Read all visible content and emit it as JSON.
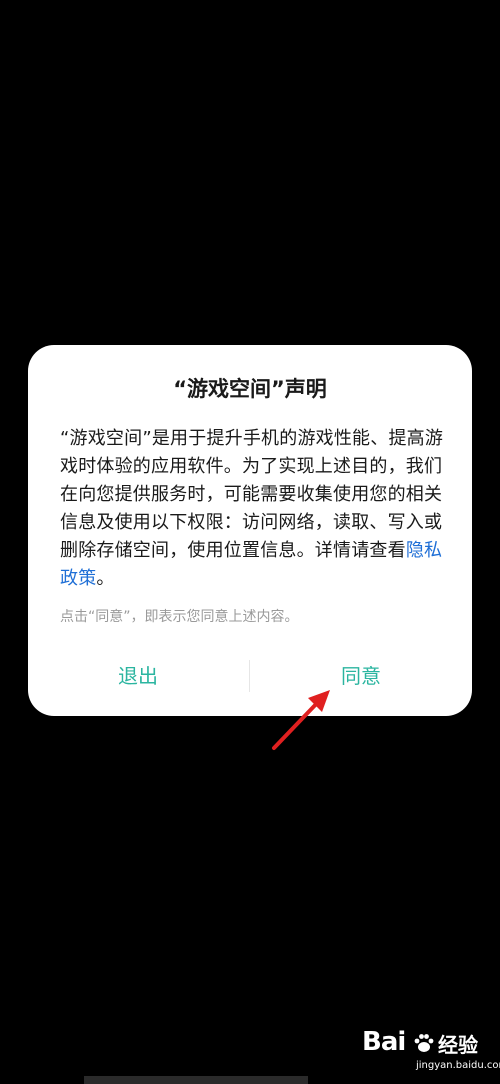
{
  "dialog": {
    "title": "“游戏空间”声明",
    "body_text": "“游戏空间”是用于提升手机的游戏性能、提高游戏时体验的应用软件。为了实现上述目的，我们在向您提供服务时，可能需要收集使用您的相关信息及使用以下权限：访问网络，读取、写入或删除存储空间，使用位置信息。详情请查看",
    "policy_link": "隐私政策",
    "body_end": "。",
    "hint": "点击“同意”，即表示您同意上述内容。",
    "exit_label": "退出",
    "agree_label": "同意"
  },
  "watermark": {
    "logo_text": "Bai",
    "jingyan": "经验",
    "domain": "jingyan.baidu.com"
  },
  "colors": {
    "background": "#000000",
    "dialog": "#ffffff",
    "accent": "#2bb5a0",
    "link": "#1f6fd6",
    "hint": "#9a9a9a",
    "arrow": "#e02020"
  },
  "icons": {
    "arrow": "red-pointer-arrow-icon",
    "paw": "baidu-paw-icon"
  }
}
